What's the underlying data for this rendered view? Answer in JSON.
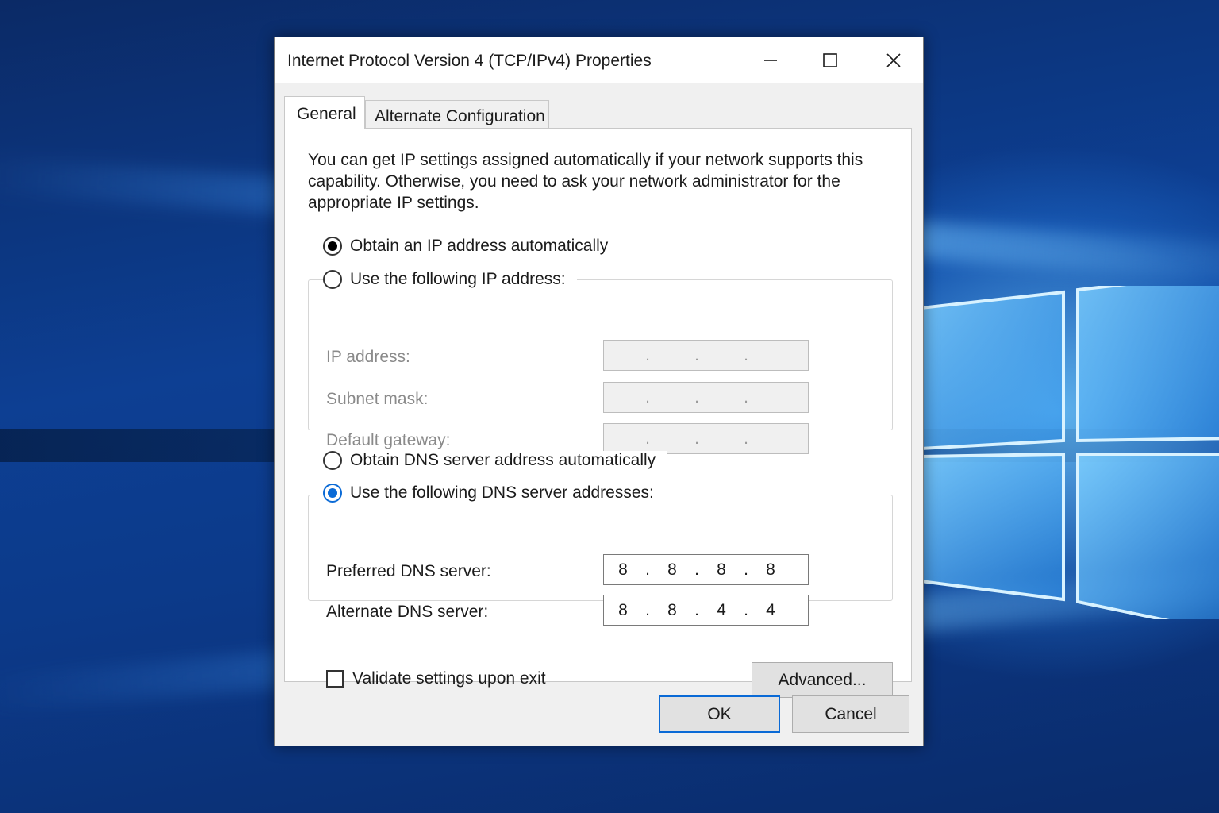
{
  "window": {
    "title": "Internet Protocol Version 4 (TCP/IPv4) Properties"
  },
  "tabs": [
    {
      "label": "General",
      "selected": true
    },
    {
      "label": "Alternate Configuration",
      "selected": false
    }
  ],
  "general": {
    "description": "You can get IP settings assigned automatically if your network supports this capability. Otherwise, you need to ask your network administrator for the appropriate IP settings.",
    "ip_mode": {
      "auto_label": "Obtain an IP address automatically",
      "manual_label": "Use the following IP address:",
      "selected": "auto"
    },
    "ip_fields": [
      {
        "label": "IP address:",
        "octets": [
          "",
          "",
          "",
          ""
        ]
      },
      {
        "label": "Subnet mask:",
        "octets": [
          "",
          "",
          "",
          ""
        ]
      },
      {
        "label": "Default gateway:",
        "octets": [
          "",
          "",
          "",
          ""
        ]
      }
    ],
    "dns_mode": {
      "auto_label": "Obtain DNS server address automatically",
      "manual_label": "Use the following DNS server addresses:",
      "selected": "manual"
    },
    "dns_fields": [
      {
        "label": "Preferred DNS server:",
        "octets": [
          "8",
          "8",
          "8",
          "8"
        ]
      },
      {
        "label": "Alternate DNS server:",
        "octets": [
          "8",
          "8",
          "4",
          "4"
        ]
      }
    ],
    "validate_label": "Validate settings upon exit",
    "validate_checked": false,
    "advanced_label": "Advanced..."
  },
  "buttons": {
    "ok": "OK",
    "cancel": "Cancel"
  },
  "colors": {
    "accent": "#0a6ad6",
    "dialog_bg": "#f0f0f0",
    "panel_bg": "#ffffff"
  },
  "icons": {
    "minimize": "minimize-icon",
    "maximize": "maximize-icon",
    "close": "close-icon",
    "desktop_logo": "windows-logo-icon"
  }
}
